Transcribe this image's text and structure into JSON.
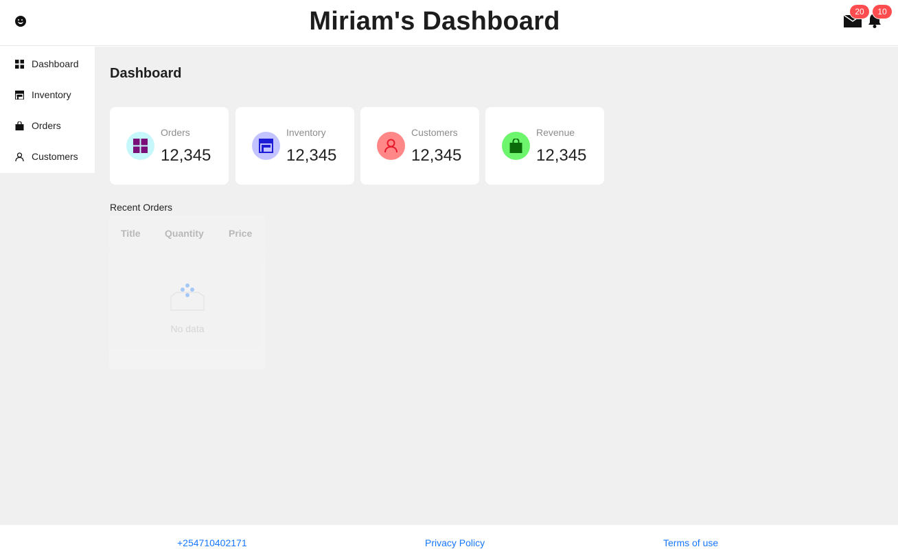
{
  "header": {
    "title": "Miriam's Dashboard",
    "mail_count": "20",
    "notification_count": "10",
    "badge_color": "#ff4d4f"
  },
  "sidebar": {
    "items": [
      {
        "label": "Dashboard",
        "icon": "appstore-icon"
      },
      {
        "label": "Inventory",
        "icon": "shop-icon"
      },
      {
        "label": "Orders",
        "icon": "shopping-bag-icon"
      },
      {
        "label": "Customers",
        "icon": "user-icon"
      }
    ]
  },
  "main": {
    "title": "Dashboard",
    "cards": [
      {
        "label": "Orders",
        "value": "12,345",
        "icon": "appstore-icon",
        "bg": "#c6f7fa",
        "fg": "#7a0f7a"
      },
      {
        "label": "Inventory",
        "value": "12,345",
        "icon": "shop-icon",
        "bg": "#c3c3ff",
        "fg": "#1c1cd6"
      },
      {
        "label": "Customers",
        "value": "12,345",
        "icon": "user-icon",
        "bg": "#ff8787",
        "fg": "#e8182b"
      },
      {
        "label": "Revenue",
        "value": "12,345",
        "icon": "shopping-bag-icon",
        "bg": "#6ef56e",
        "fg": "#0b6b0b"
      }
    ],
    "recent_orders": {
      "title": "Recent Orders",
      "columns": [
        "Title",
        "Quantity",
        "Price"
      ],
      "rows": [],
      "empty_text": "No data"
    }
  },
  "footer": {
    "phone": "+254710402171",
    "privacy": "Privacy Policy",
    "terms": "Terms of use",
    "link_color": "#1677ff"
  }
}
